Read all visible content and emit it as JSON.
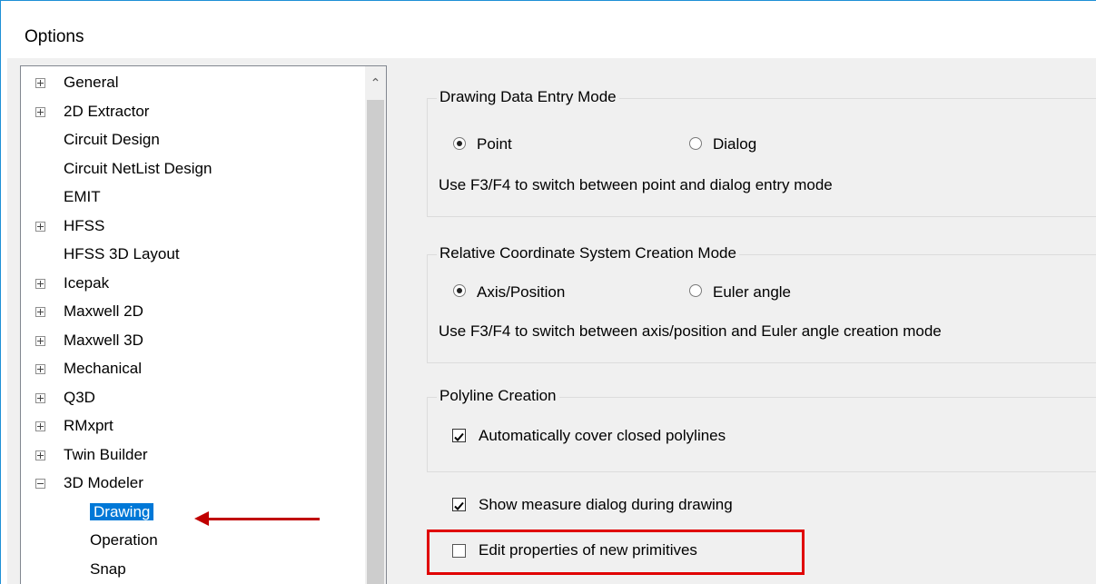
{
  "window": {
    "title": "Options"
  },
  "tree": {
    "items": [
      {
        "label": "General",
        "expander": "plus"
      },
      {
        "label": "2D Extractor",
        "expander": "plus"
      },
      {
        "label": "Circuit Design",
        "expander": ""
      },
      {
        "label": "Circuit NetList Design",
        "expander": ""
      },
      {
        "label": "EMIT",
        "expander": ""
      },
      {
        "label": "HFSS",
        "expander": "plus"
      },
      {
        "label": "HFSS 3D Layout",
        "expander": ""
      },
      {
        "label": "Icepak",
        "expander": "plus"
      },
      {
        "label": "Maxwell 2D",
        "expander": "plus"
      },
      {
        "label": "Maxwell 3D",
        "expander": "plus"
      },
      {
        "label": "Mechanical",
        "expander": "plus"
      },
      {
        "label": "Q3D",
        "expander": "plus"
      },
      {
        "label": "RMxprt",
        "expander": "plus"
      },
      {
        "label": "Twin Builder",
        "expander": "plus"
      },
      {
        "label": "3D Modeler",
        "expander": "minus"
      }
    ],
    "children": [
      {
        "label": "Drawing",
        "selected": true
      },
      {
        "label": "Operation",
        "selected": false
      },
      {
        "label": "Snap",
        "selected": false
      }
    ]
  },
  "drawing_mode": {
    "title": "Drawing Data Entry Mode",
    "option_point": "Point",
    "option_dialog": "Dialog",
    "selected": "Point",
    "hint": "Use F3/F4 to switch between point and dialog entry mode"
  },
  "coord_mode": {
    "title": "Relative Coordinate System Creation Mode",
    "option_axis": "Axis/Position",
    "option_euler": "Euler angle",
    "selected": "Axis/Position",
    "hint": "Use F3/F4 to switch between axis/position and Euler angle creation mode"
  },
  "polyline": {
    "title": "Polyline Creation",
    "cover_closed_label": "Automatically cover closed polylines",
    "cover_closed_checked": true
  },
  "options": {
    "show_measure_label": "Show measure dialog during drawing",
    "show_measure_checked": true,
    "edit_props_label": "Edit properties of new primitives",
    "edit_props_checked": false
  },
  "colors": {
    "accent": "#0078d7",
    "annotation": "#e00000"
  }
}
